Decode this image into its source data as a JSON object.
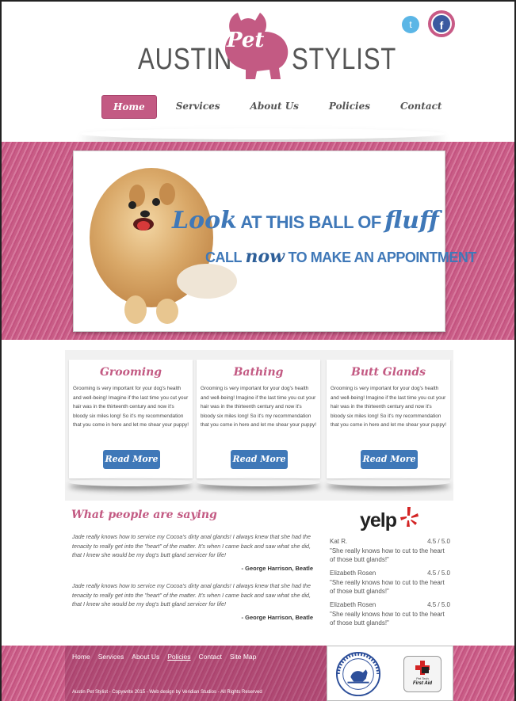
{
  "brand": {
    "word_left": "AUSTIN",
    "word_pet": "Pet",
    "word_right": "STYLIST"
  },
  "social": {
    "twitter_glyph": "t",
    "facebook_glyph": "f"
  },
  "nav": {
    "items": [
      {
        "label": "Home",
        "active": true
      },
      {
        "label": "Services"
      },
      {
        "label": "About Us"
      },
      {
        "label": "Policies"
      },
      {
        "label": "Contact"
      }
    ]
  },
  "hero": {
    "line1_script1": "Look",
    "line1_caps": "AT THIS BALL OF",
    "line1_script2": "fluff",
    "line2_caps1": "CALL",
    "line2_script": "now",
    "line2_caps2": "TO MAKE AN APPOINTMENT"
  },
  "services": [
    {
      "title": "Grooming",
      "body": "Grooming is very important for your dog's health and well-being! Imagine if the last time you cut your hair was in the thirteenth century and now it's bloody six miles long! So it's my recommendation that you come in here and let me shear your puppy!",
      "button": "Read More"
    },
    {
      "title": "Bathing",
      "body": "Grooming is very important for your dog's health and well-being! Imagine if the last time you cut your hair was in the thirteenth century and now it's bloody six miles long! So it's my recommendation that you come in here and let me shear your puppy!",
      "button": "Read More"
    },
    {
      "title": "Butt Glands",
      "body": "Grooming is very important for your dog's health and well-being! Imagine if the last time you cut your hair was in the thirteenth century and now it's bloody six miles long! So it's my recommendation that you come in here and let me shear your puppy!",
      "button": "Read More"
    }
  ],
  "testimonials": {
    "heading": "What people are saying",
    "quotes": [
      {
        "text": "Jade really knows how to service my Cocoa's dirty anal glands! I always knew that she had the tenacity to really get into the \"heart\" of the matter. It's when I came back and saw what she did, that I knew she would be my dog's butt gland servicer for life!",
        "author": "- George Harrison, Beatle"
      },
      {
        "text": "Jade really knows how to service my Cocoa's dirty anal glands! I always knew that she had the tenacity to really get into the \"heart\" of the matter. It's when I came back and saw what she did, that I knew she would be my dog's butt gland servicer for life!",
        "author": "- George Harrison, Beatle"
      }
    ]
  },
  "yelp": {
    "logo_text": "yelp",
    "reviews": [
      {
        "name": "Kat R.",
        "score": "4.5 / 5.0",
        "text": "\"She really knows how to cut to the heart of those butt glands!\""
      },
      {
        "name": "Elizabeth Rosen",
        "score": "4.5 / 5.0",
        "text": "\"She really knows how to cut to the heart of those butt glands!\""
      },
      {
        "name": "Elizabeth Rosen",
        "score": "4.5 / 5.0",
        "text": "\"She really knows how to cut to the heart of those butt glands!\""
      }
    ]
  },
  "footer": {
    "links": [
      {
        "label": "Home"
      },
      {
        "label": "Services"
      },
      {
        "label": "About Us"
      },
      {
        "label": "Policies",
        "underlined": true
      },
      {
        "label": "Contact"
      },
      {
        "label": "Site Map"
      }
    ],
    "copyright": "Austin Pet Stylist - Copywrite 2015 - Web design by Veridian Studios - All Rights Reserved",
    "badge1_icon": "dog-groomers-association-seal",
    "badge2_small": "Pet Tech",
    "badge2_label": "First Aid"
  },
  "colors": {
    "brand_pink": "#c35a83",
    "brand_blue": "#3f78b8"
  }
}
